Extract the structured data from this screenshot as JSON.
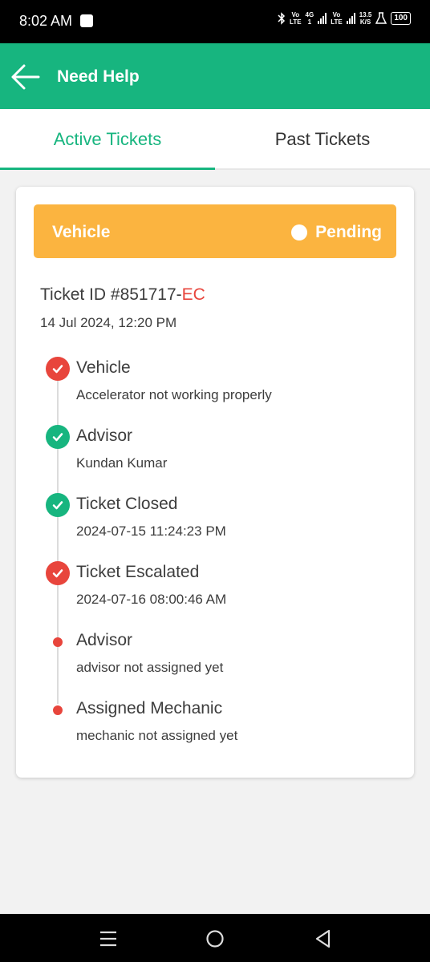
{
  "status_bar": {
    "time": "8:02 AM",
    "volte1": [
      "Vo",
      "LTE"
    ],
    "net_type": [
      "4G",
      "1"
    ],
    "volte2": [
      "Vo",
      "LTE"
    ],
    "speed": [
      "13.5",
      "K/S"
    ],
    "battery": "100",
    "icons": [
      "notification-icon",
      "bluetooth-icon",
      "signal-icon",
      "flask-icon",
      "battery-icon"
    ]
  },
  "header": {
    "title": "Need Help",
    "back_icon": "arrow-left-icon"
  },
  "tabs": [
    {
      "label": "Active Tickets",
      "active": true
    },
    {
      "label": "Past Tickets",
      "active": false
    }
  ],
  "ticket": {
    "category": "Vehicle",
    "status": "Pending",
    "id_prefix": "Ticket ID #851717-",
    "id_suffix": "EC",
    "date": "14 Jul 2024, 12:20 PM",
    "timeline": [
      {
        "title": "Vehicle",
        "subtitle": "Accelerator not working properly",
        "icon": "check-icon",
        "state": "red"
      },
      {
        "title": "Advisor",
        "subtitle": "Kundan Kumar",
        "icon": "check-icon",
        "state": "green"
      },
      {
        "title": "Ticket Closed",
        "subtitle": "2024-07-15 11:24:23 PM",
        "icon": "check-icon",
        "state": "green"
      },
      {
        "title": "Ticket Escalated",
        "subtitle": "2024-07-16 08:00:46 AM",
        "icon": "check-icon",
        "state": "red"
      },
      {
        "title": "Advisor",
        "subtitle": "advisor not assigned yet",
        "icon": "dot-icon",
        "state": "pending"
      },
      {
        "title": "Assigned Mechanic",
        "subtitle": "mechanic not assigned yet",
        "icon": "dot-icon",
        "state": "pending"
      }
    ]
  },
  "colors": {
    "brand_green": "#17b57f",
    "pending_orange": "#fbb440",
    "alert_red": "#e8453c"
  },
  "nav": [
    "menu-icon",
    "home-icon",
    "back-icon"
  ]
}
